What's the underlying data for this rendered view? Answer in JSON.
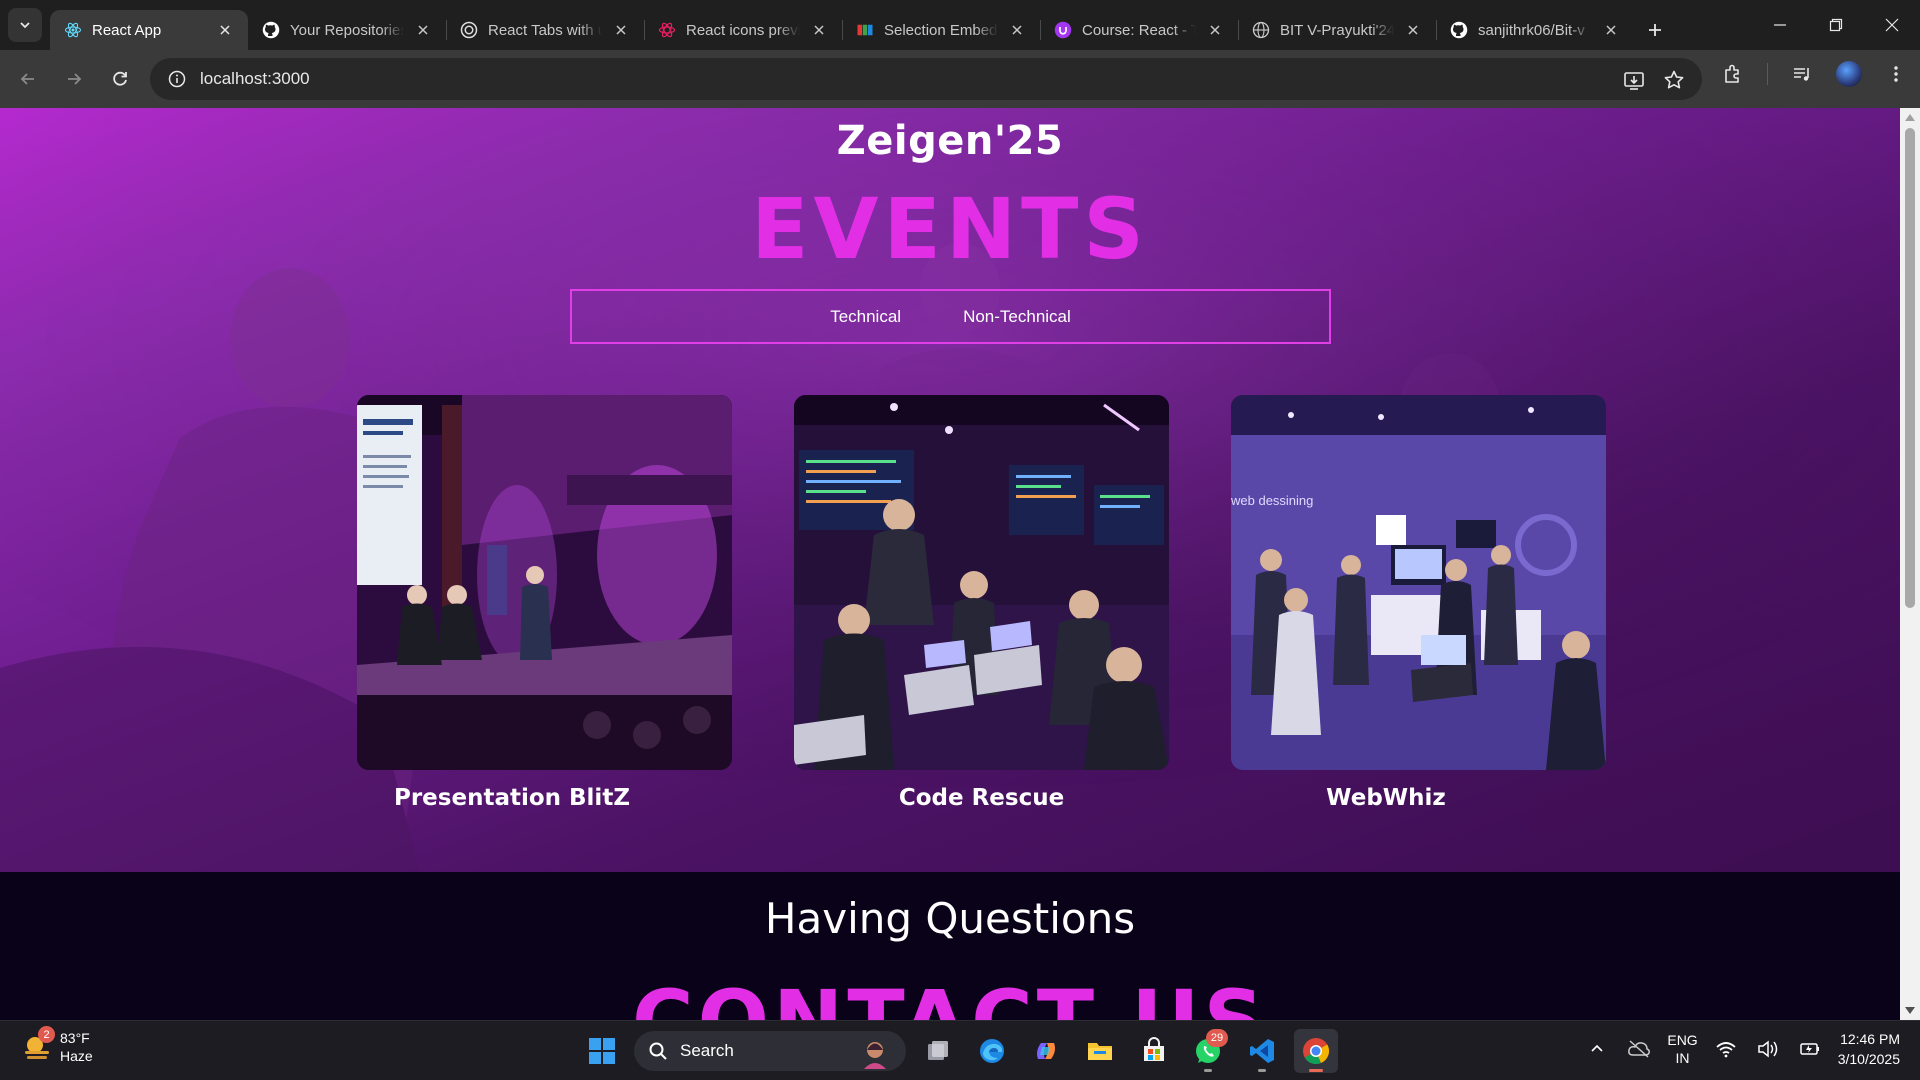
{
  "browser": {
    "tabs": [
      {
        "title": "React App",
        "icon": "react-icon",
        "active": true
      },
      {
        "title": "Your Repositories",
        "icon": "github-icon",
        "active": false
      },
      {
        "title": "React Tabs with u",
        "icon": "openai-icon",
        "active": false
      },
      {
        "title": "React icons previ",
        "icon": "react-icons-icon",
        "active": false
      },
      {
        "title": "Selection Embed",
        "icon": "zoho-icon",
        "active": false
      },
      {
        "title": "Course: React - T",
        "icon": "course-icon",
        "active": false
      },
      {
        "title": "BIT V-Prayukti'24",
        "icon": "globe-icon",
        "active": false
      },
      {
        "title": "sanjithrk06/Bit-v",
        "icon": "github-icon",
        "active": false
      }
    ],
    "url": "localhost:3000"
  },
  "page": {
    "site_title": "Zeigen'25",
    "events_heading": "EVENTS",
    "tabs": [
      {
        "label": "Technical"
      },
      {
        "label": "Non-Technical"
      }
    ],
    "events": [
      {
        "title": "Presentation BlitZ"
      },
      {
        "title": "Code Rescue"
      },
      {
        "title": "WebWhiz"
      }
    ],
    "questions_text": "Having Questions",
    "contact_heading": "CONTACT US",
    "colors": {
      "accent": "#e22fe6",
      "gradient_start": "#b62ad0",
      "gradient_end": "#3a0d4f",
      "dark_bg": "#0a0218"
    }
  },
  "taskbar": {
    "weather": {
      "badge": "2",
      "temp": "83°F",
      "condition": "Haze"
    },
    "search_label": "Search",
    "whatsapp_badge": "29",
    "language": {
      "line1": "ENG",
      "line2": "IN"
    },
    "clock": {
      "time": "12:46 PM",
      "date": "3/10/2025"
    }
  }
}
